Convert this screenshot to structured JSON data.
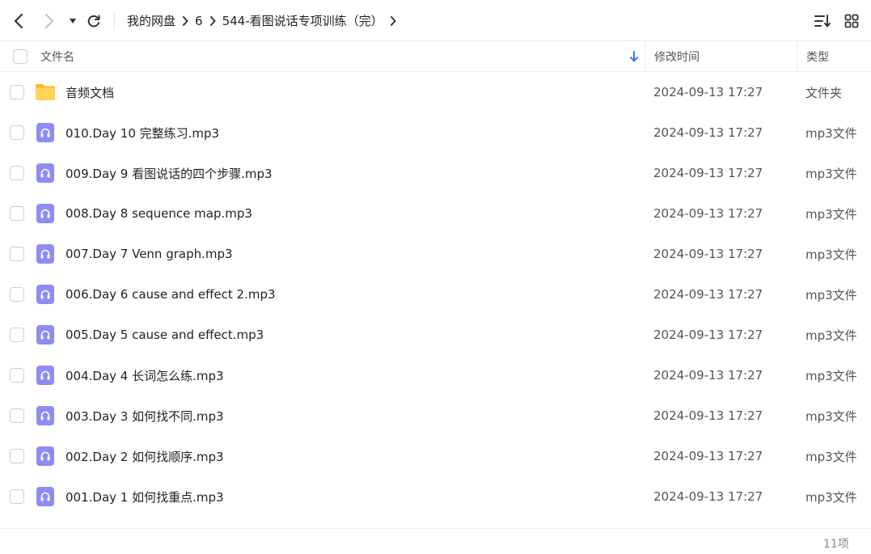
{
  "toolbar": {
    "breadcrumbs": [
      "我的网盘",
      "6",
      "544-看图说话专项训练（完）"
    ]
  },
  "columns": {
    "name": "文件名",
    "mtime": "修改时间",
    "type": "类型"
  },
  "files": [
    {
      "name": "音频文档",
      "date": "2024-09-13 17:27",
      "type": "文件夹",
      "icon": "folder-icon"
    },
    {
      "name": "010.Day 10 完整练习.mp3",
      "date": "2024-09-13 17:27",
      "type": "mp3文件",
      "icon": "audio-file-icon"
    },
    {
      "name": "009.Day 9 看图说话的四个步骤.mp3",
      "date": "2024-09-13 17:27",
      "type": "mp3文件",
      "icon": "audio-file-icon"
    },
    {
      "name": "008.Day 8 sequence map.mp3",
      "date": "2024-09-13 17:27",
      "type": "mp3文件",
      "icon": "audio-file-icon"
    },
    {
      "name": "007.Day 7 Venn graph.mp3",
      "date": "2024-09-13 17:27",
      "type": "mp3文件",
      "icon": "audio-file-icon"
    },
    {
      "name": "006.Day 6 cause and effect 2.mp3",
      "date": "2024-09-13 17:27",
      "type": "mp3文件",
      "icon": "audio-file-icon"
    },
    {
      "name": "005.Day 5 cause and effect.mp3",
      "date": "2024-09-13 17:27",
      "type": "mp3文件",
      "icon": "audio-file-icon"
    },
    {
      "name": "004.Day 4 长词怎么练.mp3",
      "date": "2024-09-13 17:27",
      "type": "mp3文件",
      "icon": "audio-file-icon"
    },
    {
      "name": "003.Day 3 如何找不同.mp3",
      "date": "2024-09-13 17:27",
      "type": "mp3文件",
      "icon": "audio-file-icon"
    },
    {
      "name": "002.Day 2 如何找顺序.mp3",
      "date": "2024-09-13 17:27",
      "type": "mp3文件",
      "icon": "audio-file-icon"
    },
    {
      "name": "001.Day 1 如何找重点.mp3",
      "date": "2024-09-13 17:27",
      "type": "mp3文件",
      "icon": "audio-file-icon"
    }
  ],
  "footer": {
    "count": "11项"
  },
  "colors": {
    "audio_icon": "#8e8cf4",
    "folder": "#ffc93c",
    "sort_arrow": "#2b7bf5"
  }
}
